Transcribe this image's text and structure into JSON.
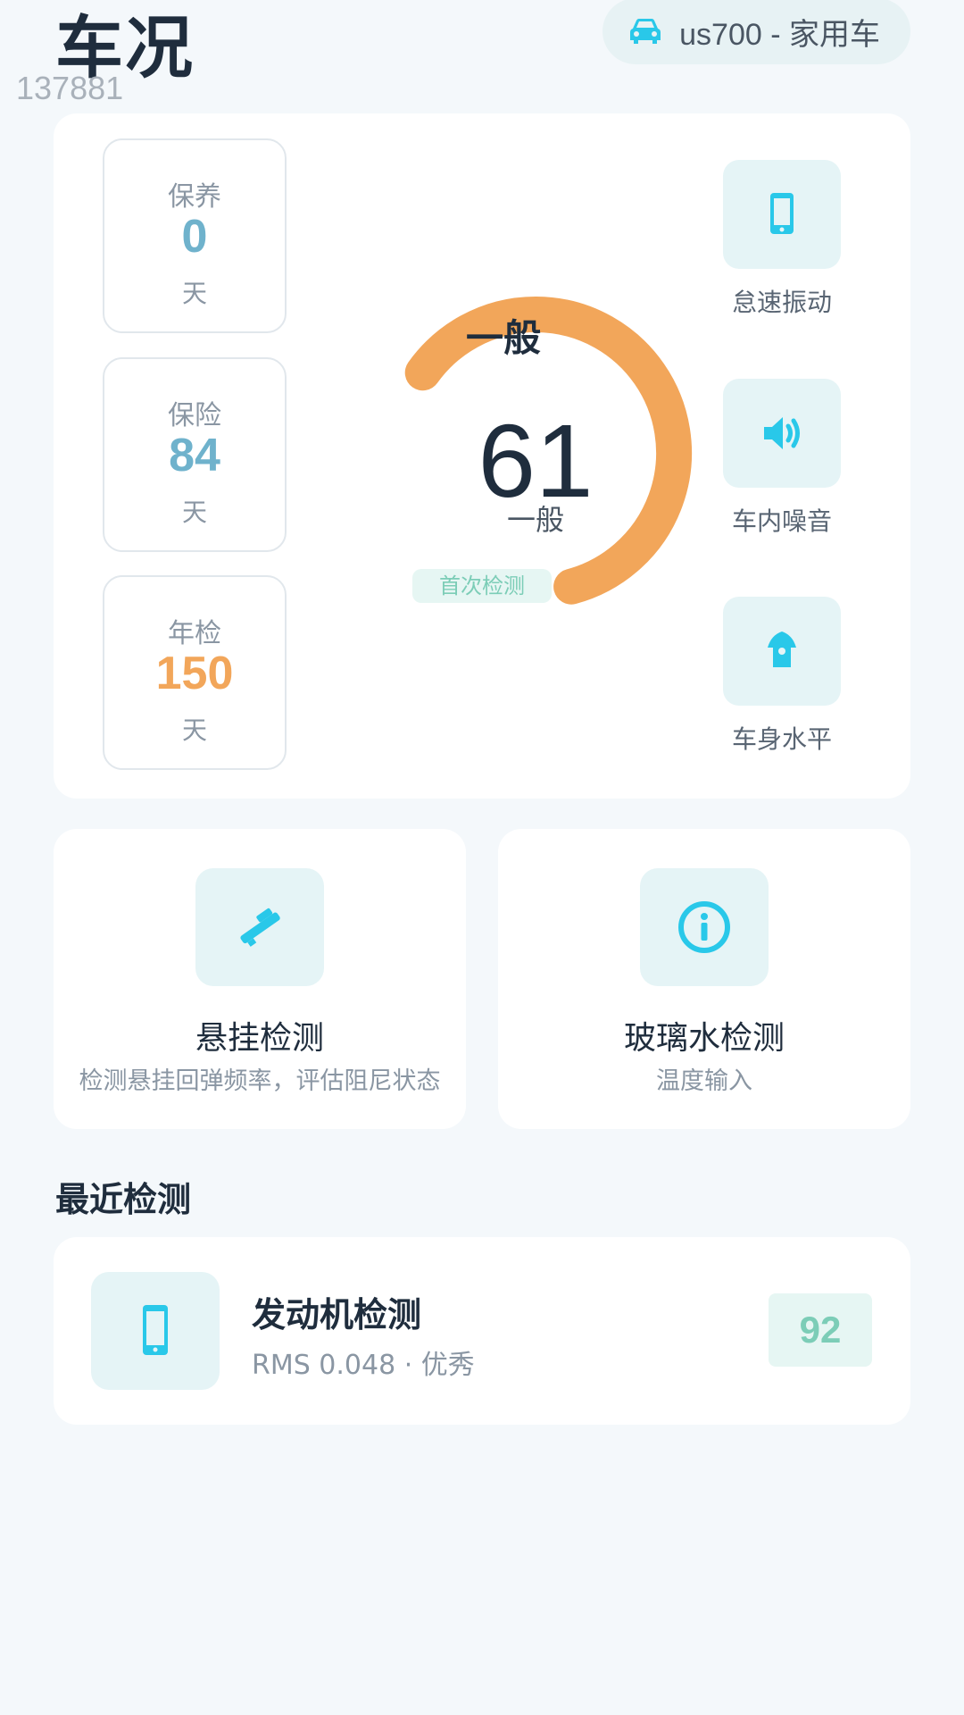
{
  "header": {
    "title": "车况",
    "watermark": "137881",
    "vehicle": "us700 - 家用车"
  },
  "colors": {
    "accent": "#29c8e9",
    "gauge": "#f2a65a",
    "blue_value": "#6fb2cc",
    "orange_value": "#f2a65a",
    "green_badge": "#7ccdb7"
  },
  "stats": [
    {
      "label": "保养",
      "value": "0",
      "unit": "天"
    },
    {
      "label": "保险",
      "value": "84",
      "unit": "天"
    },
    {
      "label": "年检",
      "value": "150",
      "unit": "天"
    }
  ],
  "gauge": {
    "level": "一般",
    "score": "61",
    "sublevel": "一般",
    "badge": "首次检测",
    "fraction": 0.61
  },
  "checks": [
    {
      "label": "怠速振动",
      "icon": "phone-icon"
    },
    {
      "label": "车内噪音",
      "icon": "speaker-icon"
    },
    {
      "label": "车身水平",
      "icon": "level-icon"
    }
  ],
  "features": [
    {
      "title": "悬挂检测",
      "desc": "检测悬挂回弹频率，评估阻尼状态",
      "icon": "suspension-icon"
    },
    {
      "title": "玻璃水检测",
      "desc": "温度输入",
      "icon": "info-icon"
    }
  ],
  "recent": {
    "section_title": "最近检测",
    "items": [
      {
        "name": "发动机检测",
        "meta": "RMS 0.048 · 优秀",
        "score": "92",
        "icon": "phone-icon"
      }
    ]
  }
}
